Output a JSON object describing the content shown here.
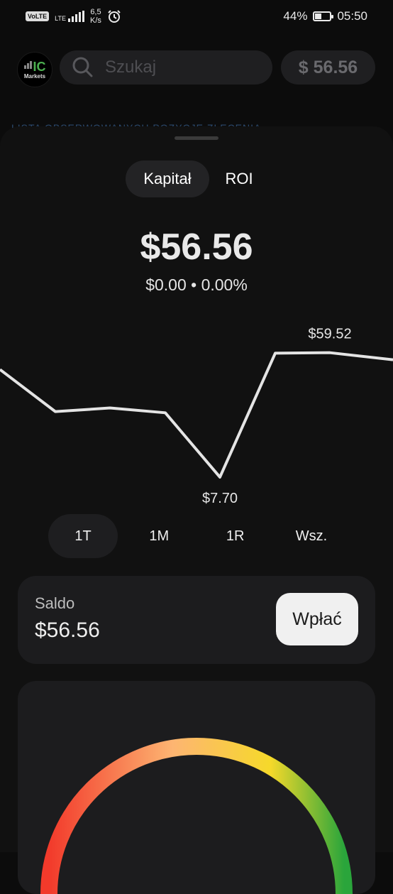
{
  "status_bar": {
    "volte": "VoLTE",
    "lte": "LTE",
    "net_speed_value": "6,5",
    "net_speed_unit": "K/s",
    "battery": "44%",
    "battery_level": 0.44,
    "time": "05:50"
  },
  "header": {
    "logo_ic": "IC",
    "logo_text": "Markets",
    "search_placeholder": "Szukaj",
    "balance": "$ 56.56"
  },
  "tabs_behind": "LISTA OBSERWOWANYCH  POZYCJE  ZLECENIA",
  "segment": {
    "capital": "Kapitał",
    "roi": "ROI",
    "active": "capital"
  },
  "summary": {
    "value": "$56.56",
    "change": "$0.00 • 0.00%"
  },
  "chart_data": {
    "type": "line",
    "values": [
      52.5,
      35.0,
      36.5,
      34.5,
      7.7,
      59.3,
      59.52,
      56.56
    ],
    "ylim": [
      0,
      68
    ],
    "labels": {
      "max": "$59.52",
      "min": "$7.70"
    },
    "line_color": "#e4e4e4"
  },
  "ranges": {
    "items": [
      "1T",
      "1M",
      "1R",
      "Wsz."
    ],
    "active": 0
  },
  "balance_card": {
    "label": "Saldo",
    "value": "$56.56",
    "deposit_label": "Wpłać"
  },
  "gauge": {
    "colors": [
      "#f23a2b",
      "#fdb572",
      "#f6d92a",
      "#2aa53b"
    ]
  }
}
